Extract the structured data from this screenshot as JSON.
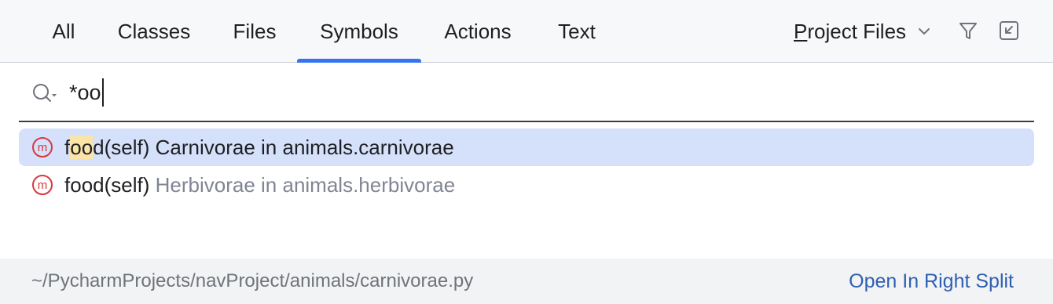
{
  "tabs": [
    {
      "label": "All"
    },
    {
      "label": "Classes"
    },
    {
      "label": "Files"
    },
    {
      "label": "Symbols",
      "active": true
    },
    {
      "label": "Actions"
    },
    {
      "label": "Text"
    }
  ],
  "scope": {
    "mnemonic": "P",
    "rest": "roject Files"
  },
  "toolbar": {
    "filter_icon": "filter-icon",
    "collapse_icon": "open-in-find-window-icon"
  },
  "search": {
    "value": "*oo",
    "icon": "search-history-icon"
  },
  "results": [
    {
      "icon": "method-icon",
      "icon_letter": "m",
      "pre": "f",
      "match": "oo",
      "post": "d(self)",
      "context": " Carnivorae in animals.carnivorae",
      "selected": true
    },
    {
      "icon": "method-icon",
      "icon_letter": "m",
      "pre": "f",
      "match": "oo",
      "post": "d(self)",
      "context": " Herbivorae in animals.herbivorae",
      "selected": false
    }
  ],
  "footer": {
    "path": "~/PycharmProjects/navProject/animals/carnivorae.py",
    "open_split_label": "Open In Right Split"
  },
  "colors": {
    "accent": "#3574f0",
    "selection": "#d5e1fb",
    "match_highlight": "#fbe4a7",
    "method_icon": "#d7383f",
    "link": "#2f5fb3"
  }
}
